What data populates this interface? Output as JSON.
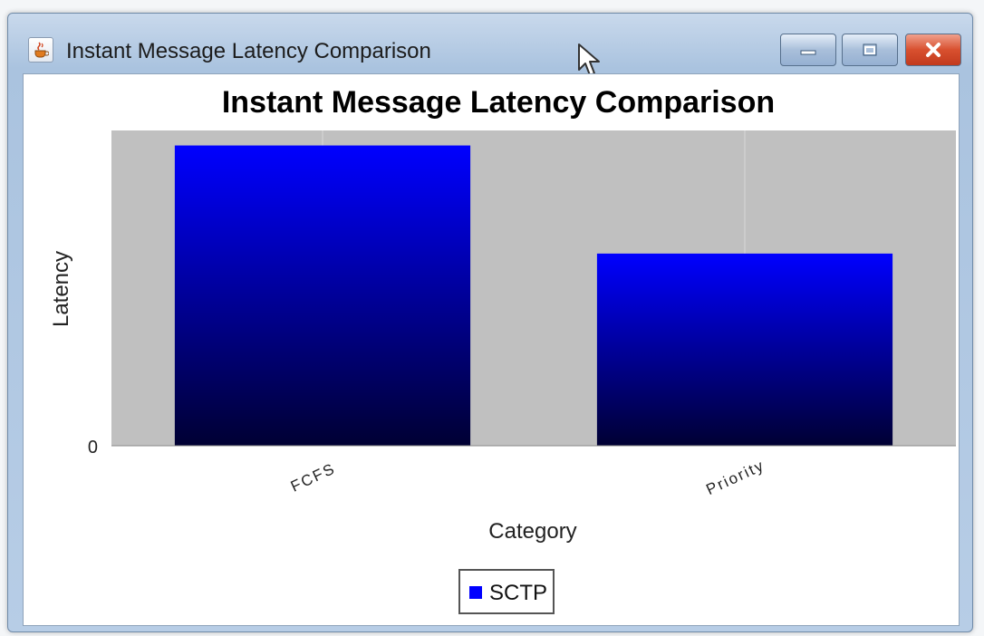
{
  "window": {
    "title": "Instant Message Latency Comparison",
    "icon": "java-coffee-icon"
  },
  "controls": {
    "minimize_icon": "minimize-icon",
    "maximize_icon": "maximize-icon",
    "close_icon": "close-icon"
  },
  "colors": {
    "bar_top": "#0000ff",
    "bar_bottom": "#000033",
    "plot_background": "#c0c0c0",
    "legend_swatch": "#0000ff"
  },
  "chart_data": {
    "type": "bar",
    "title": "Instant Message Latency Comparison",
    "xlabel": "Category",
    "ylabel": "Latency",
    "categories": [
      "FCFS",
      "Priority"
    ],
    "series": [
      {
        "name": "SCTP",
        "values": [
          100,
          64
        ]
      }
    ],
    "ylim": [
      0,
      105
    ],
    "y_tick_labels": [
      "0"
    ],
    "grid": true,
    "legend": "bottom"
  }
}
